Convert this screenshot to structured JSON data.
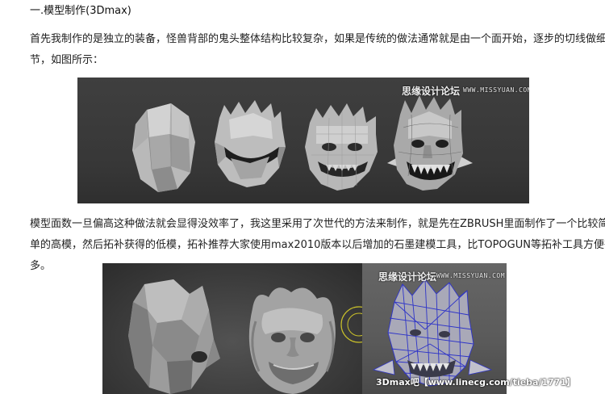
{
  "article": {
    "heading": "一.模型制作(3Dmax)",
    "paragraph1": "首先我制作的是独立的装备，怪兽背部的鬼头整体结构比较复杂，如果是传统的做法通常就是由一个面开始，逐步的切线做细节，如图所示：",
    "paragraph2": "模型面数一旦偏高这种做法就会显得没效率了，我这里采用了次世代的方法来制作，就是先在ZBRUSH里面制作了一个比较简单的高模，然后拓补获得的低模，拓补推荐大家使用max2010版本以后增加的石墨建模工具，比TOPOGUN等拓补工具方便很多。"
  },
  "figure1": {
    "watermark_cn": "思缘设计论坛",
    "watermark_en": "WWW.MISSYUAN.COM"
  },
  "figure3": {
    "watermark_cn": "思缘设计论坛",
    "watermark_en": "WWW.MISSYUAN.COM",
    "footer": "3Dmax吧【www.linecg.com/tieba/1771】"
  }
}
